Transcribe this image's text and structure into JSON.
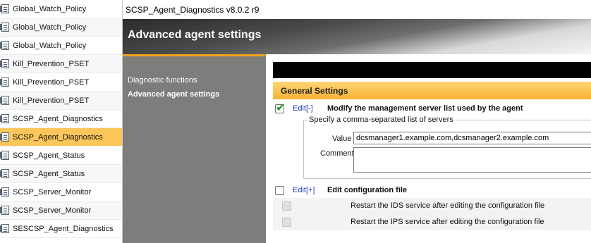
{
  "policy_list": [
    {
      "label": "Global_Watch_Policy"
    },
    {
      "label": "Global_Watch_Policy"
    },
    {
      "label": "Global_Watch_Policy"
    },
    {
      "label": "Kill_Prevention_PSET"
    },
    {
      "label": "Kill_Prevention_PSET"
    },
    {
      "label": "Kill_Prevention_PSET"
    },
    {
      "label": "SCSP_Agent_Diagnostics"
    },
    {
      "label": "SCSP_Agent_Diagnostics",
      "selected": true
    },
    {
      "label": "SCSP_Agent_Status"
    },
    {
      "label": "SCSP_Agent_Status"
    },
    {
      "label": "SCSP_Server_Monitor"
    },
    {
      "label": "SCSP_Server_Monitor"
    },
    {
      "label": "SESCSP_Agent_Diagnostics"
    }
  ],
  "window": {
    "title": "SCSP_Agent_Diagnostics v8.0.2 r9",
    "banner_title": "Advanced agent settings"
  },
  "nav": {
    "items": [
      {
        "label": "Diagnostic functions",
        "active": false
      },
      {
        "label": "Advanced agent settings",
        "active": true
      }
    ]
  },
  "general_settings": {
    "header": "General Settings",
    "management_server": {
      "checked": true,
      "edit_link": "Edit[-]",
      "label": "Modify the management server list used by the agent",
      "legend": "Specify a comma-separated list of servers",
      "value_label": "Value",
      "value": "dcsmanager1.example.com,dcsmanager2.example.com",
      "comment_label": "Comment",
      "comment": ""
    },
    "config_file": {
      "checked": false,
      "edit_link": "Edit[+]",
      "label": "Edit configuration file"
    },
    "restart_ids": {
      "checked": false,
      "label": "Restart the IDS service after editing the configuration file"
    },
    "restart_ips": {
      "checked": false,
      "label": "Restart the IPS service after editing the configuration file"
    }
  },
  "colors": {
    "selected_row": "#fbc65a",
    "section_header": "#f6b232",
    "nav_panel": "#7d7d7c",
    "nav_accent": "#f2a21b",
    "edit_link": "#1f3fb8",
    "checkmark": "#1d9b1d"
  }
}
